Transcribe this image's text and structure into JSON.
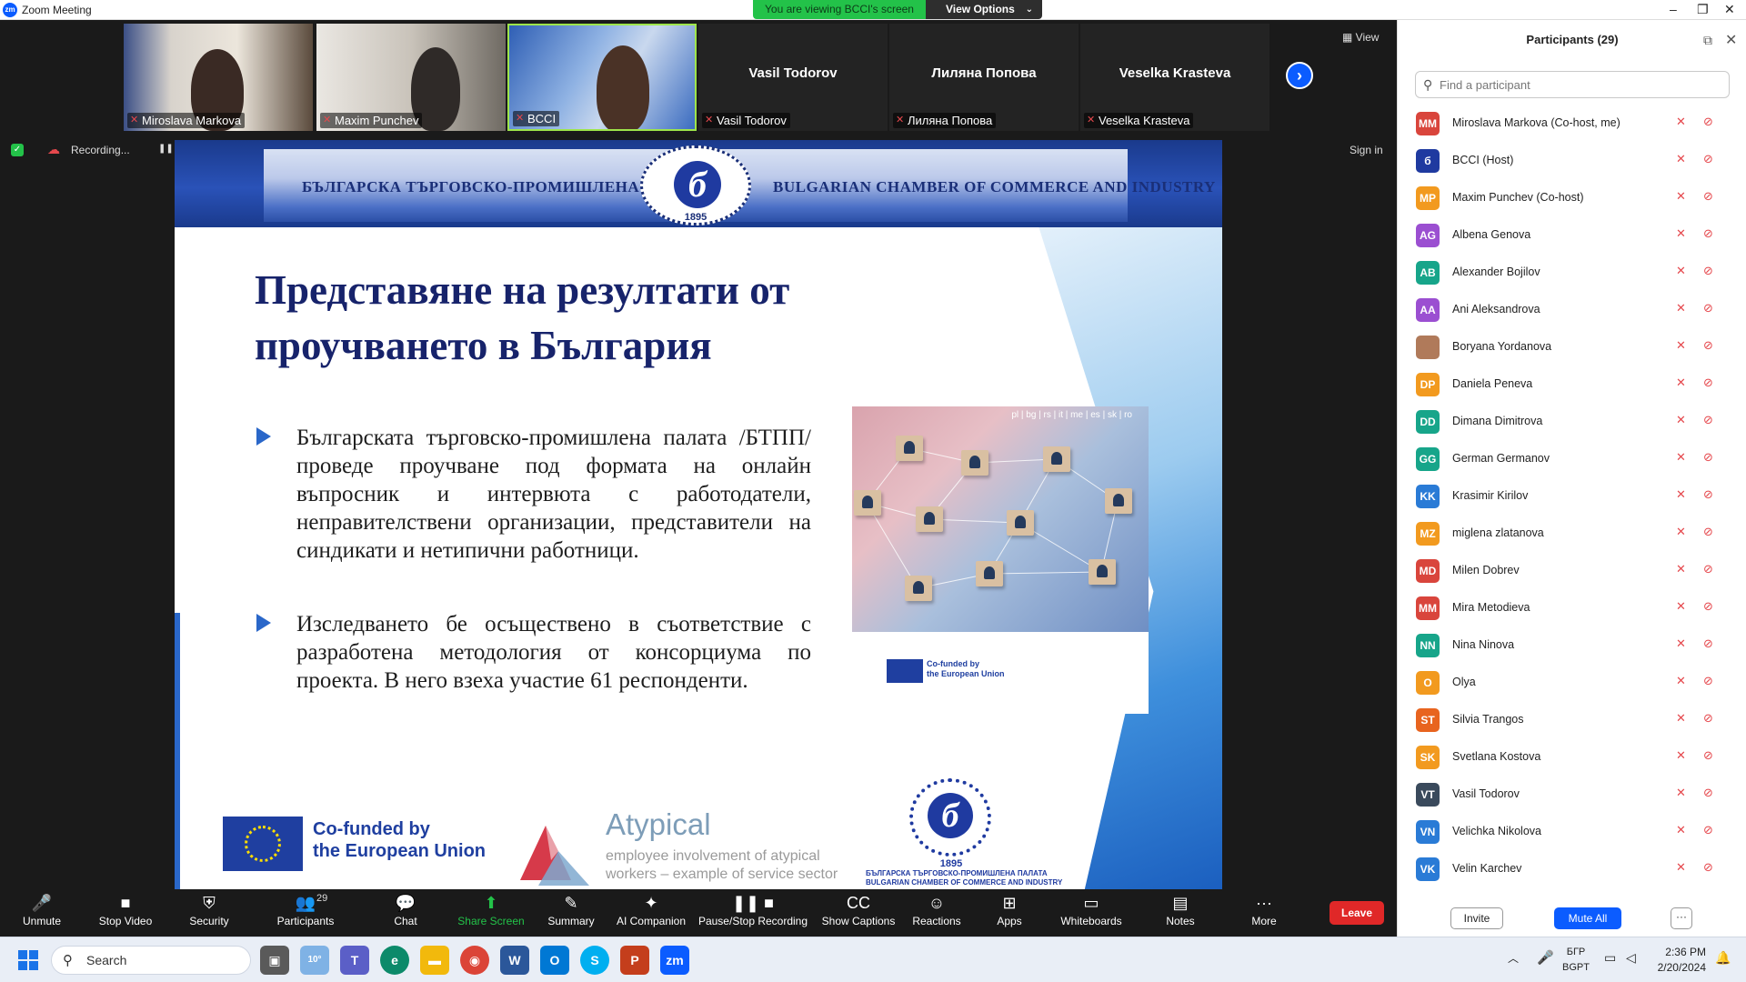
{
  "window": {
    "title": "Zoom Meeting",
    "min": "–",
    "max": "❐",
    "close": "✕"
  },
  "banner": {
    "viewing": "You are viewing BCCI's screen",
    "view_options": "View Options",
    "chevron": "⌄"
  },
  "thumbnails": [
    {
      "name": "Miroslava Markova",
      "video": true
    },
    {
      "name": "Maxim Punchev",
      "video": true
    },
    {
      "name": "BCCI",
      "video": true
    },
    {
      "name": "Vasil Todorov",
      "label": "Vasil Todorov",
      "video": false
    },
    {
      "name": "Лиляна Попова",
      "label": "Лиляна Попова",
      "video": false
    },
    {
      "name": "Veselka Krasteva",
      "label": "Veselka Krasteva",
      "video": false
    }
  ],
  "view_button": "View",
  "next_arrow": "›",
  "recording": {
    "label": "Recording...",
    "pause": "❚❚",
    "stop": "■"
  },
  "sign_in": "Sign in",
  "slide": {
    "banner_left": "БЪЛГАРСКА ТЪРГОВСКО-ПРОМИШЛЕНА ПАЛАТА",
    "banner_right": "BULGARIAN CHAMBER OF COMMERCE AND INDUSTRY",
    "seal_glyph": "б",
    "seal_year": "1895",
    "title_line1": "Представяне на резултати от",
    "title_line2": "проучването в България",
    "bullet1": "Българската търговско-промишлена палата /БТПП/ проведе проучване под формата на онлайн въпросник и интервюта с работодатели, неправителствени организации, представители на синдикати и нетипични работници.",
    "bullet2": "Изследването бе осъществено в съответствие с разработена методология от консорциума по проекта. В него взеха участие 61 респонденти.",
    "photo_langs": "pl | bg | rs | it | me | es | sk | ro",
    "photo_cofund1": "Co-funded by",
    "photo_cofund2": "the European Union",
    "eu_line1": "Co-funded by",
    "eu_line2": "the European Union",
    "atypical_name": "Atypical",
    "atypical_sub1": "employee involvement of atypical",
    "atypical_sub2": "workers – example of service sector",
    "bcci_year": "1895",
    "bcci_line1": "БЪЛГАРСКА ТЪРГОВСКО-ПРОМИШЛЕНА ПАЛАТА",
    "bcci_line2": "BULGARIAN CHAMBER OF COMMERCE AND INDUSTRY"
  },
  "participants_panel": {
    "title": "Participants (29)",
    "popout": "⧉",
    "close": "✕",
    "search_placeholder": "Find a participant",
    "invite": "Invite",
    "mute_all": "Mute All",
    "more": "···",
    "list": [
      {
        "initials": "MM",
        "name": "Miroslava Markova (Co-host, me)",
        "color": "#d9453c"
      },
      {
        "initials": "б",
        "name": "BCCI (Host)",
        "color": "#1f3aa0"
      },
      {
        "initials": "MP",
        "name": "Maxim Punchev (Co-host)",
        "color": "#f29a1f"
      },
      {
        "initials": "AG",
        "name": "Albena Genova",
        "color": "#9b4fd1"
      },
      {
        "initials": "AB",
        "name": "Alexander Bojilov",
        "color": "#17a58a"
      },
      {
        "initials": "AA",
        "name": "Ani Aleksandrova",
        "color": "#9b4fd1"
      },
      {
        "initials": "",
        "name": "Boryana Yordanova",
        "color": "#b07a5a"
      },
      {
        "initials": "DP",
        "name": "Daniela Peneva",
        "color": "#f29a1f"
      },
      {
        "initials": "DD",
        "name": "Dimana Dimitrova",
        "color": "#17a58a"
      },
      {
        "initials": "GG",
        "name": "German Germanov",
        "color": "#17a58a"
      },
      {
        "initials": "KK",
        "name": "Krasimir Kirilov",
        "color": "#2a7bd6"
      },
      {
        "initials": "MZ",
        "name": "miglena zlatanova",
        "color": "#f29a1f"
      },
      {
        "initials": "MD",
        "name": "Milen Dobrev",
        "color": "#d9453c"
      },
      {
        "initials": "MM",
        "name": "Mira Metodieva",
        "color": "#d9453c"
      },
      {
        "initials": "NN",
        "name": "Nina Ninova",
        "color": "#17a58a"
      },
      {
        "initials": "O",
        "name": "Olya",
        "color": "#f29a1f"
      },
      {
        "initials": "ST",
        "name": "Silvia Trangos",
        "color": "#e8641f"
      },
      {
        "initials": "SK",
        "name": "Svetlana Kostova",
        "color": "#f29a1f"
      },
      {
        "initials": "VT",
        "name": "Vasil Todorov",
        "color": "#3a4a5c"
      },
      {
        "initials": "VN",
        "name": "Velichka Nikolova",
        "color": "#2a7bd6"
      },
      {
        "initials": "VK",
        "name": "Velin Karchev",
        "color": "#2a7bd6"
      }
    ]
  },
  "toolbar": [
    {
      "label": "Unmute",
      "icon": "🎤"
    },
    {
      "label": "Stop Video",
      "icon": "■"
    },
    {
      "label": "Security",
      "icon": "⛨"
    },
    {
      "label": "Participants",
      "icon": "👥",
      "count": "29"
    },
    {
      "label": "Chat",
      "icon": "💬"
    },
    {
      "label": "Share Screen",
      "icon": "⬆"
    },
    {
      "label": "Summary",
      "icon": "✎"
    },
    {
      "label": "AI Companion",
      "icon": "✦"
    },
    {
      "label": "Pause/Stop Recording",
      "icon": "❚❚ ■"
    },
    {
      "label": "Show Captions",
      "icon": "CC"
    },
    {
      "label": "Reactions",
      "icon": "☺"
    },
    {
      "label": "Apps",
      "icon": "⊞"
    },
    {
      "label": "Whiteboards",
      "icon": "▭"
    },
    {
      "label": "Notes",
      "icon": "▤"
    },
    {
      "label": "More",
      "icon": "···"
    }
  ],
  "leave": "Leave",
  "taskbar": {
    "search": "Search",
    "weather": "10°",
    "lang1": "БГР",
    "lang2": "BGPT",
    "time": "2:36 PM",
    "date": "2/20/2024"
  },
  "colors": {
    "accent": "#0b5cff",
    "muted": "#e5484d",
    "leave": "#e02828",
    "share": "#23c249"
  }
}
